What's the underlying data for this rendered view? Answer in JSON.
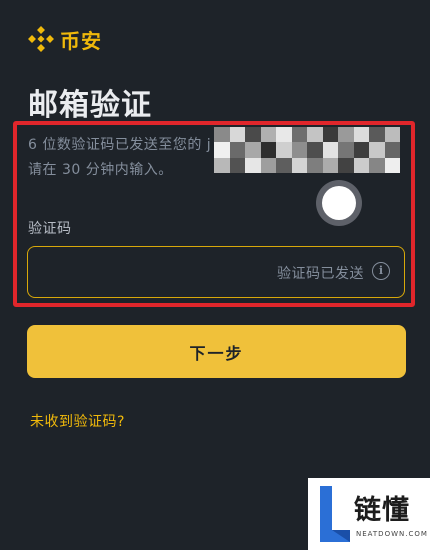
{
  "header": {
    "brand_name": "币安",
    "logo_icon": "binance-logo-icon",
    "brand_color": "#f0b90b"
  },
  "page": {
    "title": "邮箱验证"
  },
  "info": {
    "line1": "6 位数验证码已发送至您的 j",
    "line2": "请在 30 分钟内输入。"
  },
  "form": {
    "code_label": "验证码",
    "code_value": "",
    "code_placeholder": "",
    "sent_hint": "验证码已发送",
    "info_icon": "info-icon"
  },
  "actions": {
    "next_label": "下一步",
    "resend_label": "未收到验证码?"
  },
  "watermark": {
    "text": "链懂",
    "subtext": "NEATDOWN.COM"
  },
  "colors": {
    "background": "#1e2329",
    "accent_yellow": "#f0c13a",
    "highlight_red": "#e0262b",
    "muted_text": "#848e9c"
  }
}
